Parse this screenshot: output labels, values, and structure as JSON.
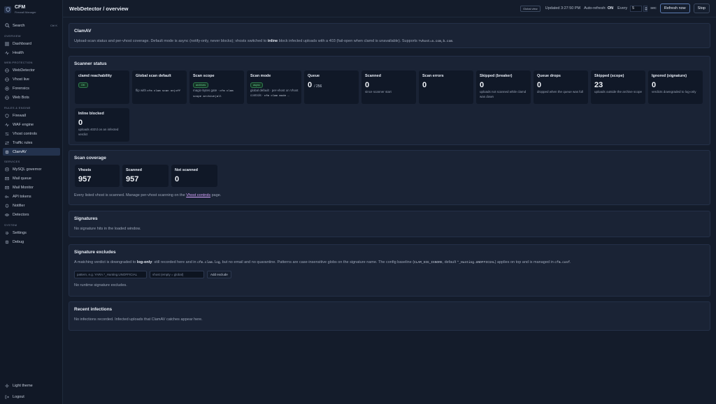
{
  "brand": {
    "name": "CFM",
    "subtitle": "Firewall Manager"
  },
  "sidebar": {
    "search": {
      "label": "Search",
      "shortcut": "Ctrl K"
    },
    "sections": [
      {
        "label": "Overview",
        "items": [
          {
            "label": "Dashboard",
            "icon": "grid-icon"
          },
          {
            "label": "Health",
            "icon": "pulse-icon"
          }
        ]
      },
      {
        "label": "Web protection",
        "items": [
          {
            "label": "WebDetector",
            "icon": "globe-icon"
          },
          {
            "label": "Vhost live",
            "icon": "globe-icon"
          },
          {
            "label": "Forensics",
            "icon": "target-icon"
          },
          {
            "label": "Web Bots",
            "icon": "globe-icon"
          }
        ]
      },
      {
        "label": "Rules & engine",
        "items": [
          {
            "label": "Firewall",
            "icon": "shield-icon"
          },
          {
            "label": "WAF engine",
            "icon": "pulse-icon"
          },
          {
            "label": "Vhost controls",
            "icon": "sliders-icon"
          },
          {
            "label": "Traffic rules",
            "icon": "arrows-icon"
          },
          {
            "label": "ClamAV",
            "icon": "bug-icon"
          }
        ]
      },
      {
        "label": "Services",
        "items": [
          {
            "label": "MySQL governor",
            "icon": "database-icon"
          },
          {
            "label": "Mail queue",
            "icon": "mail-icon"
          },
          {
            "label": "Mail Monitor",
            "icon": "mail-icon"
          },
          {
            "label": "API tokens",
            "icon": "key-icon"
          },
          {
            "label": "Notifier",
            "icon": "bell-icon"
          },
          {
            "label": "Detectors",
            "icon": "eye-icon"
          }
        ]
      },
      {
        "label": "System",
        "items": [
          {
            "label": "Settings",
            "icon": "gear-icon"
          },
          {
            "label": "Debug",
            "icon": "bug-icon"
          }
        ]
      }
    ],
    "active": "ClamAV",
    "bottom": {
      "theme": "Light theme",
      "logout": "Logout"
    }
  },
  "header": {
    "title": "WebDetector / overview",
    "scope_badge": "Global view",
    "updated": "Updated 3:27:50 PM",
    "auto_refresh_label": "Auto-refresh:",
    "auto_refresh_state": "ON",
    "every_label": "Every",
    "every_value": "5",
    "every_unit": "sec",
    "refresh_button": "Refresh now",
    "stop_button": "Stop"
  },
  "clamav": {
    "title": "ClamAV",
    "desc_a": "Upload-scan status and per-vhost coverage. Default mode is async (notify-only, never blocks); vhosts switched to ",
    "desc_b": "inline",
    "desc_c": " block infected uploads with a 403 (fail-open when clamd is unavailable). Supports ",
    "desc_code": "?vhost=a.com,b.com",
    "desc_d": "."
  },
  "scanner": {
    "title": "Scanner status",
    "tiles": [
      {
        "title": "clamd reachability",
        "pill": "OK"
      },
      {
        "title": "Global scan default",
        "desc_pre": "flip with ",
        "desc_code": "cfm clam scan on|off"
      },
      {
        "title": "Scan scope",
        "pill": "archives",
        "desc_pre": "magic-bytes gate · ",
        "desc_code": "cfm clam scope archive|all"
      },
      {
        "title": "Scan mode",
        "pill": "async",
        "desc_pre": "global default · per-vhost on Vhost controls · ",
        "desc_code": "cfm clam mode …"
      },
      {
        "title": "Queue",
        "value": "0",
        "value_suffix": "/ 256"
      },
      {
        "title": "Scanned",
        "value": "0",
        "desc": "since scanner start"
      },
      {
        "title": "Scan errors",
        "value": "0"
      },
      {
        "title": "Skipped (breaker)",
        "value": "0",
        "desc": "uploads not scanned while clamd was down"
      },
      {
        "title": "Queue drops",
        "value": "0",
        "desc": "dropped when the queue was full"
      },
      {
        "title": "Skipped (scope)",
        "value": "23",
        "desc": "uploads outside the archive scope"
      },
      {
        "title": "Ignored (signature)",
        "value": "0",
        "desc": "verdicts downgraded to log-only"
      },
      {
        "title": "Inline blocked",
        "value": "0",
        "desc": "uploads 403'd on an infected verdict"
      }
    ]
  },
  "coverage": {
    "title": "Scan coverage",
    "tiles": [
      {
        "title": "Vhosts",
        "value": "957"
      },
      {
        "title": "Scanned",
        "value": "957"
      },
      {
        "title": "Not scanned",
        "value": "0"
      }
    ],
    "note_a": "Every listed vhost is scanned. Manage per-vhost scanning on the ",
    "note_link": "Vhost controls",
    "note_b": " page."
  },
  "signatures": {
    "title": "Signatures",
    "empty": "No signature hits in the loaded window."
  },
  "excludes": {
    "title": "Signature excludes",
    "desc_a": "A matching verdict is downgraded to ",
    "desc_b": "log-only",
    "desc_c": ": still recorded here and in ",
    "desc_code1": "cfm.clam.log",
    "desc_d": ", but no email and no quarantine. Patterns are case-insensitive globs on the signature name. The config baseline (",
    "desc_code2": "CLAM_SIG_IGNORE",
    "desc_e": ", default ",
    "desc_code3": "*_Hunting.UNOFFICIAL",
    "desc_f": ") applies on top and is managed in ",
    "desc_code4": "cfm.conf",
    "desc_g": ".",
    "pattern_placeholder": "pattern, e.g. YARA.*_Hunting.UNOFFICIAL",
    "vhost_placeholder": "vhost (empty = global)",
    "add_button": "Add exclude",
    "empty": "No runtime signature excludes."
  },
  "infections": {
    "title": "Recent infections",
    "empty": "No infections recorded. Infected uploads that ClamAV catches appear here."
  }
}
